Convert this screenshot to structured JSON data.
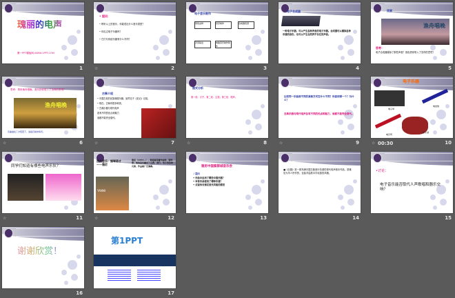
{
  "slides": [
    {
      "number": "1",
      "title": "瑰丽的电声",
      "subtitle": "第一PPT模板网-WWW.1PPT.COM"
    },
    {
      "number": "2",
      "title": "• 提问：",
      "bullets": [
        "• 聆听以上的音乐，你能说出什么音乐类型？",
        "• 你见过电子乐器吗？",
        "• 它们与传统乐器有什么不同？"
      ],
      "transition": true
    },
    {
      "number": "3",
      "title": "电子音乐制作",
      "boxes": [
        "音色采样",
        "音序制作",
        "合成器音源",
        "声音输出",
        "电脑音乐制作软件"
      ]
    },
    {
      "number": "4",
      "title": "电子合成器",
      "body": "一种电子乐器，可以产生各种声音的电子乐器。合成器可以模拟各种乐器的音色，也可以产生自然界不存在的声音。"
    },
    {
      "number": "5",
      "title": "欣赏",
      "picture_caption": "渔舟唱晚",
      "question_label": "思考：",
      "question": "电子合成器模拟了那些声音？音色把你带入了怎样的意境？"
    },
    {
      "number": "6",
      "title": "思考：再听渔舟唱晚，音乐把你带入了怎样的意境？",
      "picture_caption": "渔舟唱晚",
      "body": "该曲描绘了夕阳西下，渔船归航的情景。",
      "transition": true
    },
    {
      "number": "7",
      "title": "古筝介绍",
      "bullets": [
        "• 中国古老的民族弹拨乐器，最早见于《史记》记载。",
        "• 现在，古筝有很多种类。",
        "• 古典乐器与现代电声",
        "各有不同的优点和魅力",
        "谁都不能完全替代。"
      ],
      "transition": true
    },
    {
      "number": "8",
      "title": "曲式分析",
      "body": "第一段：引子；第二段：主题；第三段：尾声。",
      "transition": true
    },
    {
      "number": "9",
      "question": "比较同一乐曲用不同的演奏方式在什么不同？你喜欢哪一个？为什么？",
      "answer": "古典乐器与现代电声各有不同的优点和魅力，谁都不能完全替代。",
      "transition": true
    },
    {
      "number": "10",
      "title": "电子乐器",
      "labels": [
        "电子琴",
        "电吉他",
        "电贝司",
        "架子鼓"
      ],
      "transition": true,
      "timing": "00:30"
    },
    {
      "number": "11",
      "title": "同学们知道有哪些电声乐队？",
      "transition": true
    },
    {
      "number": "12",
      "title": "西方音乐：钢琴奇才——雅尼",
      "picture_caption": "YANNI",
      "body": "雅尼（1954—），希腊裔美籍作曲家、钢琴家。他的音乐融合了古典、流行、电子等多种元素，作品被广泛演奏。",
      "transition": true
    },
    {
      "number": "13",
      "title": "雅尼中国紫禁城音乐会",
      "section": "提问",
      "bullets": [
        "• 乐曲中运用了哪些中国乐器？",
        "• 本首乐曲使用了哪种乐器？",
        "• 试谈你对雅尼音乐风格的感受"
      ]
    },
    {
      "number": "14",
      "body": "■《丝路》是一首充满中国古典音乐情调的现代电声音乐作品，是雅尼为华人所作的，全曲洋溢着中华民族的风格。"
    },
    {
      "number": "15",
      "title": "•讨论：",
      "body": "电子音乐能否取代人声歌唱和器乐交响？"
    },
    {
      "number": "16",
      "title": "谢谢欣赏！"
    },
    {
      "number": "17",
      "logo_text": "第1PPT"
    }
  ],
  "colors": {
    "background": "#5a5a5a",
    "accent_magenta": "#e0177a",
    "accent_blue": "#2f3fa8"
  }
}
